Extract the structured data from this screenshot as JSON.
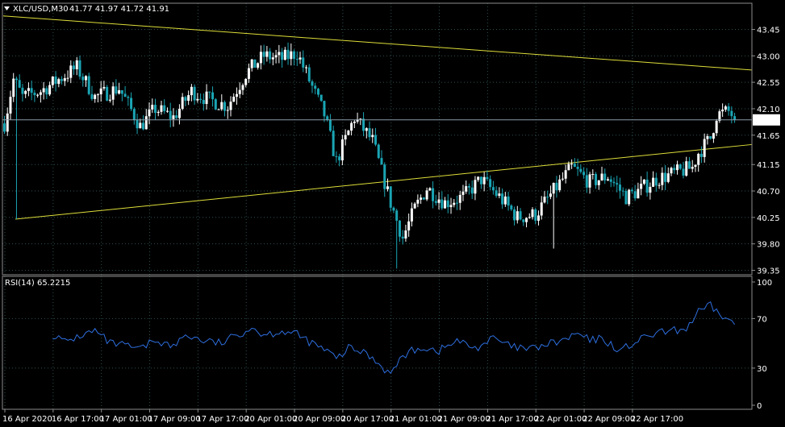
{
  "main_header": {
    "symbol_timeframe": "XLC/USD,M30",
    "ohlc": "41.77 41.97 41.72 41.91"
  },
  "rsi_header": {
    "label": "RSI(14) 65.2215"
  },
  "colors": {
    "background": "#000000",
    "grid": "#2f4f4f",
    "up_candle": "#ffffff",
    "down_candle": "#1aa5b4",
    "trendline": "#dede3a",
    "rsi_line": "#2e6fe0",
    "bid_line": "#8a9aa8",
    "axis_text": "#ffffff",
    "frame": "#8c8c8c"
  },
  "chart_data": [
    {
      "type": "candlestick",
      "symbol": "XLC/USD",
      "timeframe": "M30",
      "current_price": "41.91",
      "ylim": [
        39.3,
        43.68
      ],
      "y_ticks": [
        "43.45",
        "43.00",
        "42.55",
        "42.10",
        "41.65",
        "41.15",
        "40.70",
        "40.25",
        "39.80",
        "39.35"
      ],
      "x_ticks": [
        "16 Apr 2020",
        "16 Apr 17:00",
        "17 Apr 01:00",
        "17 Apr 09:00",
        "17 Apr 17:00",
        "20 Apr 01:00",
        "20 Apr 09:00",
        "20 Apr 17:00",
        "21 Apr 01:00",
        "21 Apr 09:00",
        "21 Apr 17:00",
        "22 Apr 01:00",
        "22 Apr 09:00",
        "22 Apr 17:00"
      ],
      "anchors": [
        [
          0,
          41.85
        ],
        [
          3,
          42.6
        ],
        [
          6,
          42.3
        ],
        [
          12,
          42.4
        ],
        [
          18,
          42.6
        ],
        [
          24,
          42.8
        ],
        [
          30,
          42.3
        ],
        [
          38,
          42.45
        ],
        [
          45,
          41.8
        ],
        [
          50,
          42.1
        ],
        [
          56,
          41.95
        ],
        [
          62,
          42.4
        ],
        [
          68,
          42.25
        ],
        [
          74,
          42.15
        ],
        [
          80,
          42.7
        ],
        [
          86,
          43.0
        ],
        [
          92,
          42.95
        ],
        [
          97,
          43.05
        ],
        [
          100,
          42.7
        ],
        [
          106,
          42.0
        ],
        [
          110,
          41.2
        ],
        [
          116,
          41.95
        ],
        [
          122,
          41.55
        ],
        [
          128,
          40.5
        ],
        [
          132,
          39.9
        ],
        [
          136,
          40.4
        ],
        [
          140,
          40.75
        ],
        [
          146,
          40.5
        ],
        [
          152,
          40.6
        ],
        [
          158,
          40.9
        ],
        [
          164,
          40.6
        ],
        [
          170,
          40.25
        ],
        [
          176,
          40.3
        ],
        [
          182,
          40.7
        ],
        [
          188,
          41.1
        ],
        [
          194,
          40.85
        ],
        [
          200,
          40.95
        ],
        [
          206,
          40.6
        ],
        [
          210,
          40.7
        ],
        [
          216,
          40.9
        ],
        [
          222,
          41.0
        ],
        [
          228,
          41.1
        ],
        [
          230,
          41.35
        ],
        [
          234,
          41.6
        ],
        [
          236,
          42.0
        ],
        [
          240,
          42.05
        ],
        [
          242,
          41.95
        ]
      ],
      "trendlines": [
        {
          "from": [
            0,
            43.68
          ],
          "to": [
            248,
            42.76
          ]
        },
        {
          "from": [
            4,
            40.22
          ],
          "to": [
            248,
            41.49
          ]
        }
      ]
    },
    {
      "type": "line",
      "name": "RSI(14)",
      "last_value": 65.2215,
      "ylim": [
        0,
        100
      ],
      "y_ticks": [
        "100",
        "70",
        "30",
        "0"
      ],
      "x_start_index": 16,
      "anchors": [
        [
          16,
          57
        ],
        [
          20,
          51
        ],
        [
          25,
          56
        ],
        [
          30,
          60
        ],
        [
          35,
          50
        ],
        [
          40,
          48
        ],
        [
          45,
          45
        ],
        [
          50,
          53
        ],
        [
          56,
          47
        ],
        [
          60,
          57
        ],
        [
          66,
          52
        ],
        [
          72,
          50
        ],
        [
          78,
          58
        ],
        [
          82,
          63
        ],
        [
          86,
          57
        ],
        [
          92,
          60
        ],
        [
          97,
          57
        ],
        [
          102,
          50
        ],
        [
          108,
          42
        ],
        [
          110,
          37
        ],
        [
          114,
          46
        ],
        [
          120,
          42
        ],
        [
          124,
          34
        ],
        [
          128,
          25
        ],
        [
          132,
          40
        ],
        [
          138,
          47
        ],
        [
          144,
          44
        ],
        [
          150,
          52
        ],
        [
          156,
          46
        ],
        [
          162,
          54
        ],
        [
          168,
          47
        ],
        [
          174,
          45
        ],
        [
          180,
          49
        ],
        [
          186,
          53
        ],
        [
          190,
          58
        ],
        [
          194,
          52
        ],
        [
          198,
          54
        ],
        [
          204,
          44
        ],
        [
          210,
          52
        ],
        [
          216,
          58
        ],
        [
          222,
          60
        ],
        [
          226,
          62
        ],
        [
          230,
          75
        ],
        [
          234,
          80
        ],
        [
          238,
          72
        ],
        [
          242,
          65
        ]
      ]
    }
  ]
}
